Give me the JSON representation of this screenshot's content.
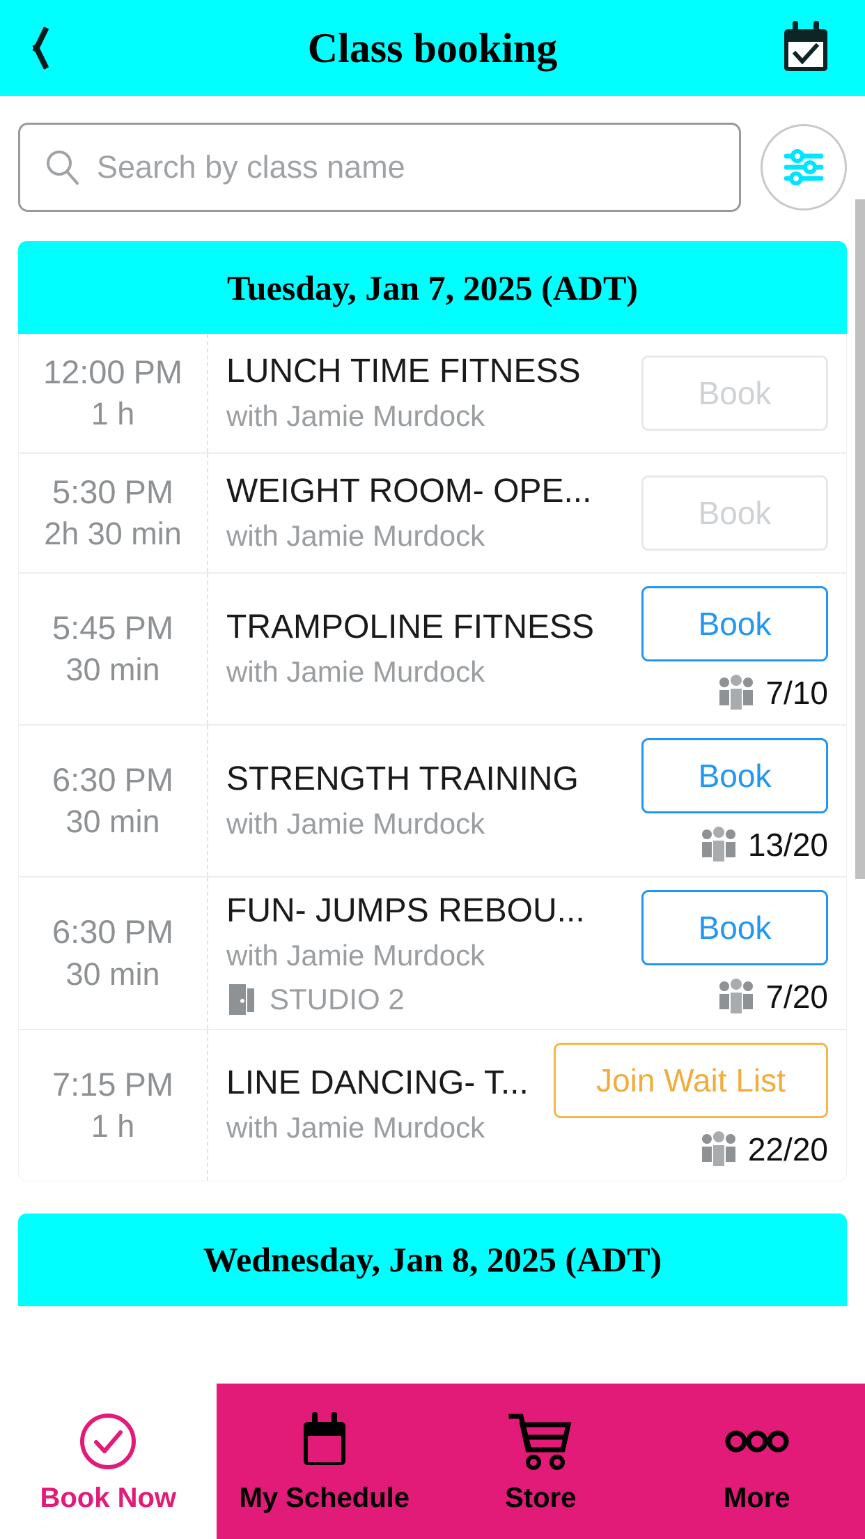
{
  "header": {
    "title": "Class booking",
    "back_icon": "back-chevron-icon",
    "action_icon": "calendar-check-icon"
  },
  "search": {
    "placeholder": "Search by class name",
    "value": "",
    "search_icon": "search-icon",
    "filter_icon": "filter-sliders-icon"
  },
  "days": [
    {
      "date_label": "Tuesday, Jan 7, 2025 (ADT)",
      "classes": [
        {
          "time": "12:00",
          "ampm": "PM",
          "duration": "1 h",
          "name": "LUNCH TIME FITNESS",
          "instructor": "with Jamie Murdock",
          "location": "",
          "action_label": "Book",
          "action_state": "disabled",
          "capacity": ""
        },
        {
          "time": "5:30",
          "ampm": "PM",
          "duration": "2h 30 min",
          "name": "WEIGHT ROOM- OPE...",
          "instructor": "with Jamie Murdock",
          "location": "",
          "action_label": "Book",
          "action_state": "disabled",
          "capacity": ""
        },
        {
          "time": "5:45",
          "ampm": "PM",
          "duration": "30 min",
          "name": "TRAMPOLINE FITNESS",
          "instructor": "with Jamie Murdock",
          "location": "",
          "action_label": "Book",
          "action_state": "active",
          "capacity": "7/10"
        },
        {
          "time": "6:30",
          "ampm": "PM",
          "duration": "30 min",
          "name": "STRENGTH TRAINING",
          "instructor": "with Jamie Murdock",
          "location": "",
          "action_label": "Book",
          "action_state": "active",
          "capacity": "13/20"
        },
        {
          "time": "6:30",
          "ampm": "PM",
          "duration": "30 min",
          "name": "FUN- JUMPS REBOU...",
          "instructor": "with Jamie Murdock",
          "location": "STUDIO 2",
          "action_label": "Book",
          "action_state": "active",
          "capacity": "7/20"
        },
        {
          "time": "7:15",
          "ampm": "PM",
          "duration": "1 h",
          "name": "LINE DANCING- T...",
          "instructor": "with Jamie Murdock",
          "location": "",
          "action_label": "Join Wait List",
          "action_state": "waitlist",
          "capacity": "22/20"
        }
      ]
    },
    {
      "date_label": "Wednesday, Jan 8, 2025 (ADT)",
      "classes": []
    }
  ],
  "tabbar": {
    "tabs": [
      {
        "label": "Book Now",
        "icon": "check-circle-icon",
        "state": "active"
      },
      {
        "label": "My Schedule",
        "icon": "calendar-icon",
        "state": "inactive"
      },
      {
        "label": "Store",
        "icon": "shopping-cart-icon",
        "state": "inactive"
      },
      {
        "label": "More",
        "icon": "ellipsis-icon",
        "state": "inactive"
      }
    ]
  },
  "colors": {
    "header_cyan": "#00ffff",
    "tabbar_pink": "#e21a78",
    "book_blue": "#2196f3",
    "waitlist_orange": "#f0ad3e",
    "disabled_gray": "#cfd2d4"
  }
}
